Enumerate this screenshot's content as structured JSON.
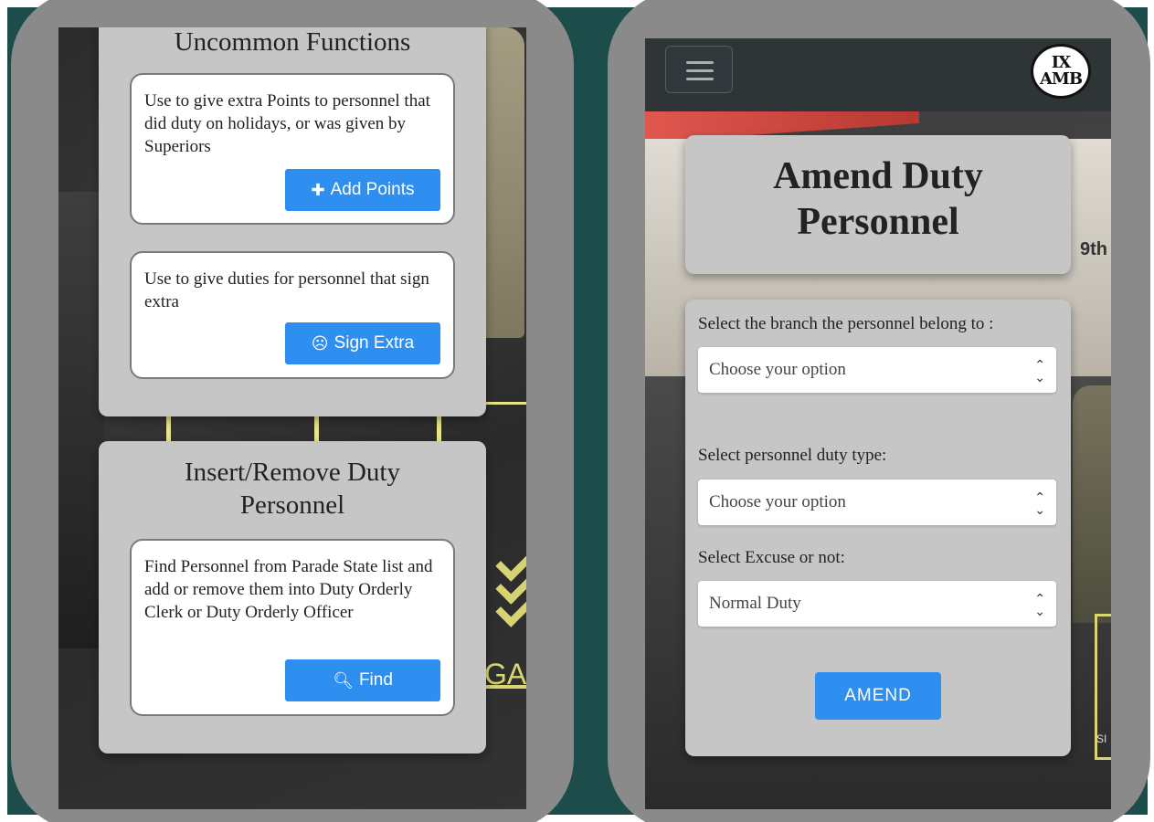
{
  "left_screen": {
    "uncommon": {
      "title": "Uncommon Functions",
      "cards": [
        {
          "text": "Use to give extra Points to personnel that did duty on holidays, or was given by Superiors",
          "button": "Add Points",
          "icon": "plus-icon"
        },
        {
          "text": "Use to give duties for personnel that sign extra",
          "button": "Sign Extra",
          "icon": "frown-icon"
        }
      ]
    },
    "insert": {
      "title": "Insert/Remove Duty Personnel",
      "card": {
        "text": "Find Personnel from Parade State list and add or remove them into Duty Orderly Clerk or Duty Orderly Officer",
        "button": "Find",
        "icon": "search-icon"
      }
    },
    "bg_text": "GAP"
  },
  "right_screen": {
    "logo": {
      "line1": "IX",
      "line2": "AMB"
    },
    "title": "Amend Duty Personnel",
    "bg_text": "9th",
    "fields": [
      {
        "label": "Select the branch the personnel belong to :",
        "value": "Choose your option"
      },
      {
        "label": "Select personnel duty type:",
        "value": "Choose your option"
      },
      {
        "label": "Select Excuse or not:",
        "value": "Normal Duty"
      }
    ],
    "submit": "AMEND",
    "bg_badge": "SI"
  },
  "colors": {
    "teal": "#1d4d4b",
    "button_blue": "#2f8ff0",
    "card": "#c6c6c6"
  }
}
